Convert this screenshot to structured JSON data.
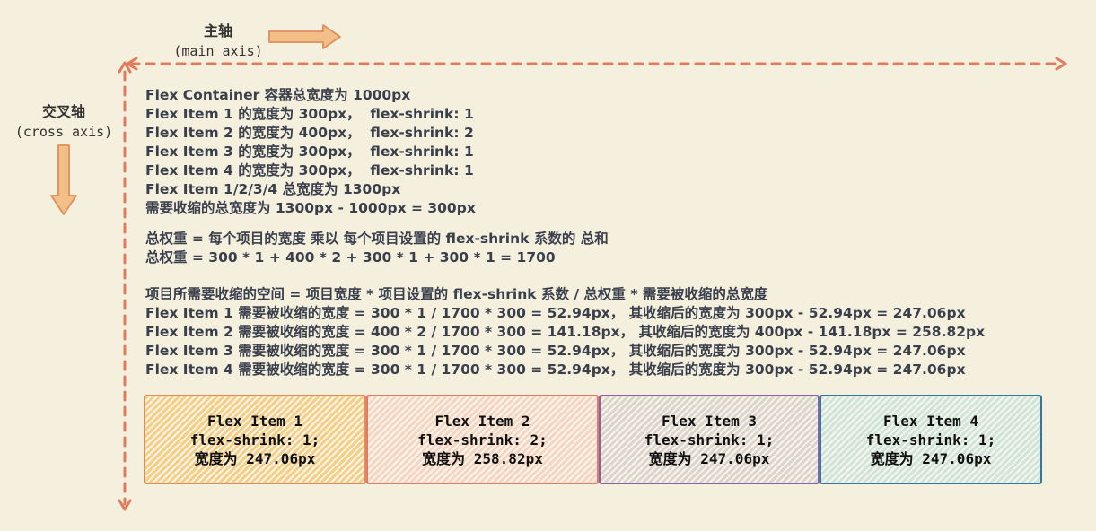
{
  "main_axis": {
    "title": "主轴",
    "subtitle": "(main axis)"
  },
  "cross_axis": {
    "title": "交叉轴",
    "subtitle": "(cross axis)"
  },
  "info_lines": [
    "Flex Container 容器总宽度为 1000px",
    "Flex Item 1 的宽度为 300px，  flex-shrink: 1",
    "Flex Item 2 的宽度为 400px，  flex-shrink: 2",
    "Flex Item 3 的宽度为 300px，  flex-shrink: 1",
    "Flex Item 4 的宽度为 300px，  flex-shrink: 1",
    "Flex Item 1/2/3/4 总宽度为 1300px",
    "需要收缩的总宽度为 1300px - 1000px = 300px"
  ],
  "weight_lines": [
    "总权重 = 每个项目的宽度 乘以 每个项目设置的 flex-shrink 系数的 总和",
    "总权重 = 300 * 1 + 400 * 2 + 300 * 1 + 300 * 1 = 1700"
  ],
  "calc_lines": [
    "项目所需要收缩的空间 = 项目宽度 * 项目设置的 flex-shrink 系数 / 总权重 * 需要被收缩的总宽度",
    "Flex Item 1 需要被收缩的宽度 = 300 * 1 / 1700 * 300 = 52.94px， 其收缩后的宽度为 300px - 52.94px = 247.06px",
    "Flex Item 2 需要被收缩的宽度 = 400 * 2 / 1700 * 300 = 141.18px， 其收缩后的宽度为 400px - 141.18px = 258.82px",
    "Flex Item 3 需要被收缩的宽度 = 300 * 1 / 1700 * 300 = 52.94px， 其收缩后的宽度为 300px - 52.94px = 247.06px",
    "Flex Item 4 需要被收缩的宽度 = 300 * 1 / 1700 * 300 = 52.94px， 其收缩后的宽度为 300px - 52.94px = 247.06px"
  ],
  "items": [
    {
      "title": "Flex Item 1",
      "shrink": "flex-shrink: 1;",
      "width_text": "宽度为 247.06px",
      "fill": "#f5cf86",
      "border": "#e08d5a"
    },
    {
      "title": "Flex Item 2",
      "shrink": "flex-shrink: 2;",
      "width_text": "宽度为 258.82px",
      "fill": "#f6d6c2",
      "border": "#e07a6a"
    },
    {
      "title": "Flex Item 3",
      "shrink": "flex-shrink: 1;",
      "width_text": "宽度为 247.06px",
      "fill": "#dcd5ce",
      "border": "#8a62a8"
    },
    {
      "title": "Flex Item 4",
      "shrink": "flex-shrink: 1;",
      "width_text": "宽度为 247.06px",
      "fill": "#cfe5dc",
      "border": "#2f78a6"
    }
  ],
  "colors": {
    "axis": "#e07b5c",
    "arrow_fill": "#f3bf88",
    "arrow_stroke": "#e08d5a",
    "background": "#f5f0de"
  }
}
